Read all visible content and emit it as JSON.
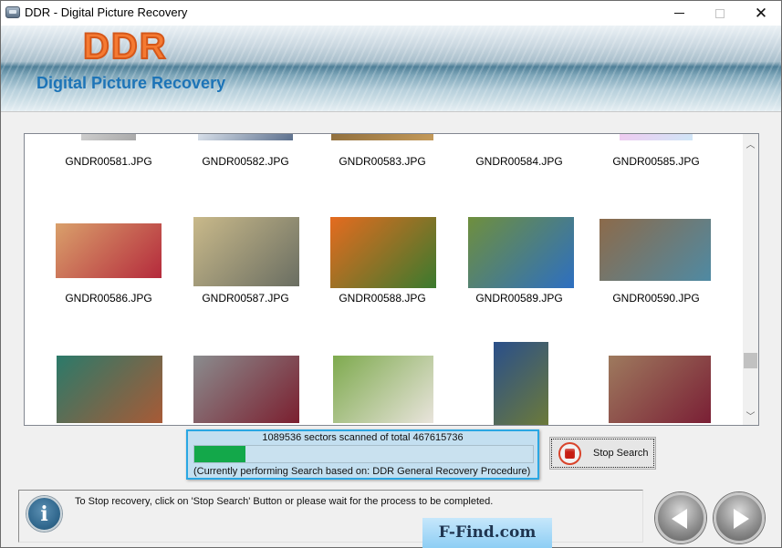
{
  "window": {
    "title": "DDR - Digital Picture Recovery",
    "controls": {
      "minimize": "minimize",
      "maximize": "maximize",
      "close": "close"
    }
  },
  "banner": {
    "logo": "DDR",
    "subtitle": "Digital Picture Recovery"
  },
  "gallery": {
    "items": [
      {
        "name": "GNDR00581.JPG",
        "colors": [
          "#d6d6d6",
          "#a8a8a8"
        ]
      },
      {
        "name": "GNDR00582.JPG",
        "colors": [
          "#e8eef6",
          "#5b6f8c"
        ]
      },
      {
        "name": "GNDR00583.JPG",
        "colors": [
          "#8a6a3a",
          "#c49a5a"
        ]
      },
      {
        "name": "GNDR00584.JPG",
        "colors": [
          "#5b2a14",
          "#c8461a"
        ]
      },
      {
        "name": "GNDR00585.JPG",
        "colors": [
          "#f5c6ef",
          "#cfe6f7"
        ]
      },
      {
        "name": "GNDR00586.JPG",
        "colors": [
          "#d9a06b",
          "#b52a3c"
        ]
      },
      {
        "name": "GNDR00587.JPG",
        "colors": [
          "#c9b98a",
          "#6a6e62"
        ]
      },
      {
        "name": "GNDR00588.JPG",
        "colors": [
          "#e56b1f",
          "#3a7a2e"
        ]
      },
      {
        "name": "GNDR00589.JPG",
        "colors": [
          "#6f8f3d",
          "#2d6fc1"
        ]
      },
      {
        "name": "GNDR00590.JPG",
        "colors": [
          "#8c6a4a",
          "#4f8aa3"
        ]
      },
      {
        "name": "",
        "colors": [
          "#2b7a6a",
          "#a85a36"
        ]
      },
      {
        "name": "",
        "colors": [
          "#8a8c8e",
          "#7b1f2f"
        ]
      },
      {
        "name": "",
        "colors": [
          "#7eaa4e",
          "#e9e4dc"
        ]
      },
      {
        "name": "",
        "colors": [
          "#2a4f8a",
          "#6c7a3a"
        ]
      },
      {
        "name": "",
        "colors": [
          "#9e7a5e",
          "#7a1f35"
        ]
      }
    ]
  },
  "progress": {
    "status": "1089536 sectors scanned of total 467615736",
    "fraction": 0.15,
    "procedure": "(Currently performing Search based on:  DDR General Recovery Procedure)"
  },
  "stop_button": {
    "label": "Stop Search",
    "icon": "stop-icon"
  },
  "info": {
    "message": "To Stop recovery, click on 'Stop Search' Button or please wait for the process to be completed.",
    "icon": "info-icon"
  },
  "watermark": "F-Find.com",
  "nav": {
    "back": "back",
    "next": "next"
  }
}
